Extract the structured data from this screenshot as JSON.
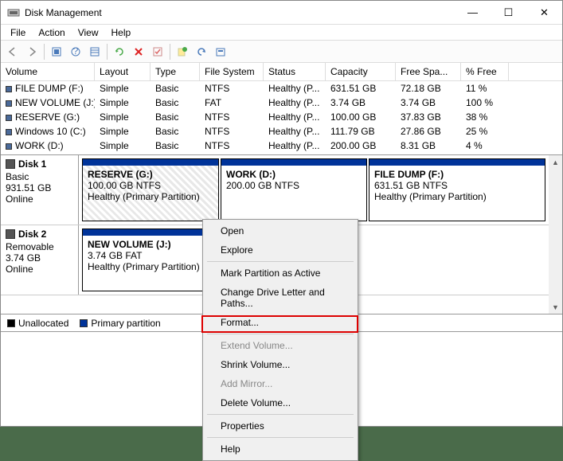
{
  "window": {
    "title": "Disk Management",
    "menu": {
      "file": "File",
      "action": "Action",
      "view": "View",
      "help": "Help"
    },
    "buttons": {
      "min": "—",
      "max": "☐",
      "close": "✕"
    }
  },
  "columns": {
    "volume": "Volume",
    "layout": "Layout",
    "type": "Type",
    "fs": "File System",
    "status": "Status",
    "capacity": "Capacity",
    "free": "Free Spa...",
    "pct": "% Free"
  },
  "volumes": [
    {
      "name": "FILE DUMP (F:)",
      "layout": "Simple",
      "type": "Basic",
      "fs": "NTFS",
      "status": "Healthy (P...",
      "cap": "631.51 GB",
      "free": "72.18 GB",
      "pct": "11 %"
    },
    {
      "name": "NEW VOLUME (J:)",
      "layout": "Simple",
      "type": "Basic",
      "fs": "FAT",
      "status": "Healthy (P...",
      "cap": "3.74 GB",
      "free": "3.74 GB",
      "pct": "100 %"
    },
    {
      "name": "RESERVE (G:)",
      "layout": "Simple",
      "type": "Basic",
      "fs": "NTFS",
      "status": "Healthy (P...",
      "cap": "100.00 GB",
      "free": "37.83 GB",
      "pct": "38 %"
    },
    {
      "name": "Windows 10 (C:)",
      "layout": "Simple",
      "type": "Basic",
      "fs": "NTFS",
      "status": "Healthy (P...",
      "cap": "111.79 GB",
      "free": "27.86 GB",
      "pct": "25 %"
    },
    {
      "name": "WORK (D:)",
      "layout": "Simple",
      "type": "Basic",
      "fs": "NTFS",
      "status": "Healthy (P...",
      "cap": "200.00 GB",
      "free": "8.31 GB",
      "pct": "4 %"
    }
  ],
  "disks": [
    {
      "name": "Disk 1",
      "type": "Basic",
      "size": "931.51 GB",
      "status": "Online",
      "parts": [
        {
          "name": "RESERVE  (G:)",
          "info": "100.00 GB NTFS",
          "health": "Healthy (Primary Partition)"
        },
        {
          "name": "WORK  (D:)",
          "info": "200.00 GB NTFS",
          "health": ""
        },
        {
          "name": "FILE DUMP  (F:)",
          "info": "631.51 GB NTFS",
          "health": "Healthy (Primary Partition)"
        }
      ]
    },
    {
      "name": "Disk 2",
      "type": "Removable",
      "size": "3.74 GB",
      "status": "Online",
      "parts": [
        {
          "name": "NEW VOLUME  (J:)",
          "info": "3.74 GB FAT",
          "health": "Healthy (Primary Partition)"
        }
      ]
    }
  ],
  "legend": {
    "unalloc": "Unallocated",
    "primary": "Primary partition"
  },
  "context": {
    "open": "Open",
    "explore": "Explore",
    "mark": "Mark Partition as Active",
    "change": "Change Drive Letter and Paths...",
    "format": "Format...",
    "extend": "Extend Volume...",
    "shrink": "Shrink Volume...",
    "mirror": "Add Mirror...",
    "delete": "Delete Volume...",
    "props": "Properties",
    "help": "Help"
  }
}
